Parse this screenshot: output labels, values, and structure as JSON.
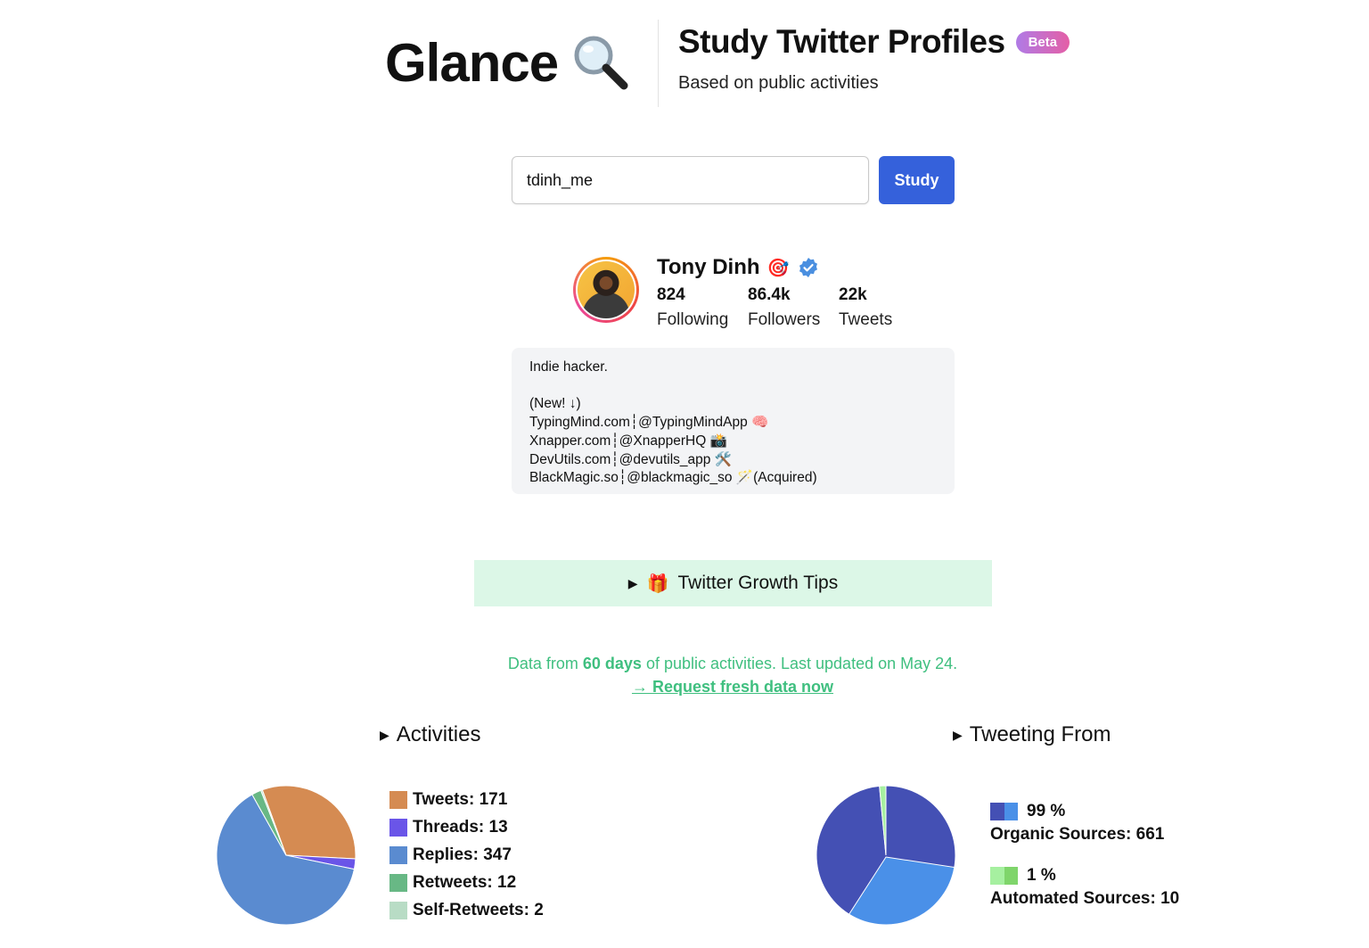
{
  "header": {
    "logo": "Glance",
    "title": "Study Twitter Profiles",
    "badge": "Beta",
    "subtitle": "Based on public activities"
  },
  "search": {
    "value": "tdinh_me",
    "button_label": "Study"
  },
  "profile": {
    "name": "Tony Dinh",
    "name_emoji": "🎯",
    "stats": [
      {
        "value": "824",
        "label": "Following"
      },
      {
        "value": "86.4k",
        "label": "Followers"
      },
      {
        "value": "22k",
        "label": "Tweets"
      }
    ],
    "bio": "Indie hacker.\n\n(New! ↓)\nTypingMind.com┆@TypingMindApp 🧠\nXnapper.com┆@XnapperHQ 📸\nDevUtils.com┆@devutils_app 🛠️\nBlackMagic.so┆@blackmagic_so 🪄(Acquired)"
  },
  "tips": {
    "label": "Twitter Growth Tips",
    "icon": "gift-icon"
  },
  "data_note": {
    "prefix": "Data from ",
    "days": "60 days",
    "suffix": " of public activities. Last updated on May 24.",
    "link": "→ Request fresh data now"
  },
  "activities": {
    "title": "Activities",
    "legend": [
      {
        "label": "Tweets: 171",
        "color": "#d58b52"
      },
      {
        "label": "Threads: 13",
        "color": "#6a55e8"
      },
      {
        "label": "Replies: 347",
        "color": "#5a8bd0"
      },
      {
        "label": "Retweets: 12",
        "color": "#68b885"
      },
      {
        "label": "Self-Retweets: 2",
        "color": "#b8dcc5"
      }
    ]
  },
  "tweeting_from": {
    "title": "Tweeting From",
    "sources": [
      {
        "percent": "99 %",
        "label": "Organic Sources: 661",
        "colors": [
          "#4450b4",
          "#4a90e8"
        ]
      },
      {
        "percent": "1 %",
        "label": "Automated Sources: 10",
        "colors": [
          "#a6f0a0",
          "#7fd56b"
        ]
      }
    ]
  },
  "chart_data": [
    {
      "type": "pie",
      "title": "",
      "categories": [
        "Tweets",
        "Threads",
        "Replies",
        "Retweets",
        "Self-Retweets"
      ],
      "values": [
        171,
        13,
        347,
        12,
        2
      ],
      "colors": [
        "#d58b52",
        "#6a55e8",
        "#5a8bd0",
        "#68b885",
        "#b8dcc5"
      ]
    },
    {
      "type": "pie",
      "title": "",
      "categories": [
        "Organic Sources",
        "Automated Sources"
      ],
      "values": [
        661,
        10
      ],
      "colors": [
        "#4450b4",
        "#4a90e8",
        "#a6f0a0",
        "#7fd56b"
      ]
    }
  ]
}
